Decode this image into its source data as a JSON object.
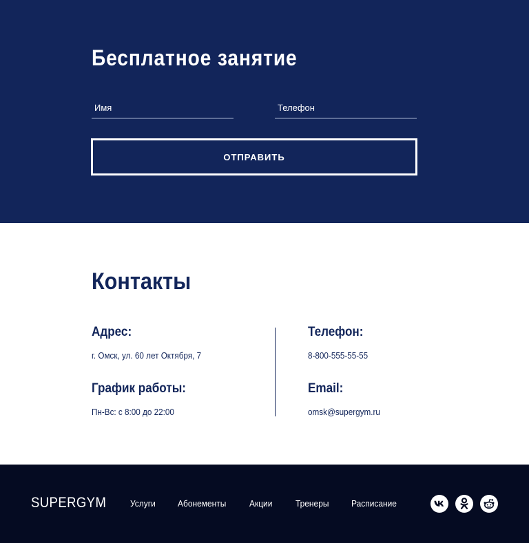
{
  "free_lesson": {
    "title": "Бесплатное занятие",
    "name_placeholder": "Имя",
    "phone_placeholder": "Телефон",
    "submit_label": "ОТПРАВИТЬ"
  },
  "contacts": {
    "title": "Контакты",
    "address_label": "Адрес:",
    "address_value": "г. Омск, ул. 60 лет Октября, 7",
    "schedule_label": "График работы:",
    "schedule_value": "Пн-Вс: с 8:00 до 22:00",
    "phone_label": "Телефон:",
    "phone_value": "8-800-555-55-55",
    "email_label": "Email:",
    "email_value": "omsk@supergym.ru"
  },
  "footer": {
    "logo": "SUPERGYM",
    "nav": [
      "Услуги",
      "Абонементы",
      "Акции",
      "Тренеры",
      "Расписание"
    ],
    "social_icons": [
      "vk-icon",
      "odnoklassniki-icon",
      "reddit-icon"
    ]
  },
  "colors": {
    "primary_navy": "#12255a",
    "footer_bg": "#050b22",
    "white": "#ffffff"
  }
}
